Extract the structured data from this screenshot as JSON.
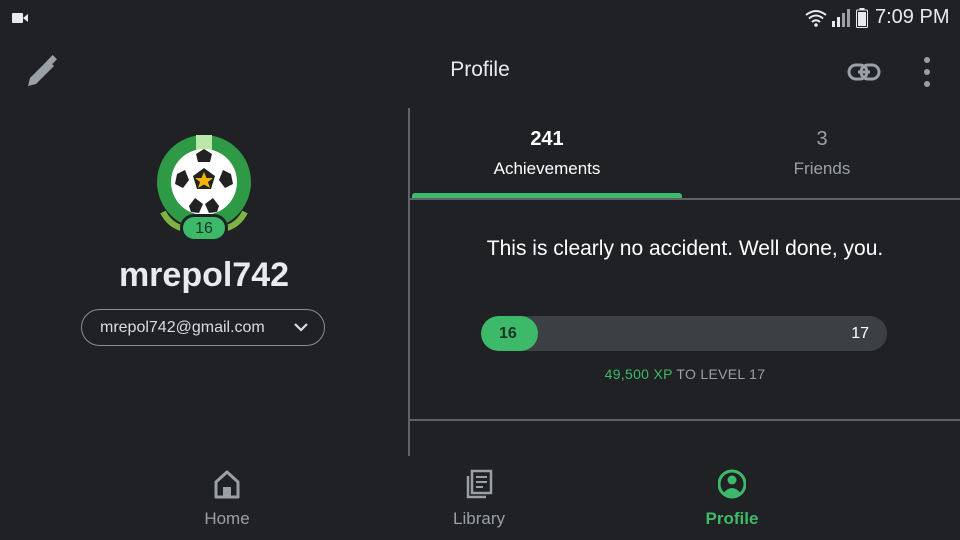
{
  "status_bar": {
    "time": "7:09 PM",
    "icons": [
      "video-icon",
      "wifi-icon",
      "signal-icon",
      "battery-icon"
    ]
  },
  "app_bar": {
    "title": "Profile",
    "icons": [
      "edit-icon",
      "link-icon",
      "more-vertical-icon"
    ]
  },
  "profile": {
    "avatar_icon": "soccer-ball-badge-icon",
    "level_badge": "16",
    "username": "mrepol742",
    "account_email": "mrepol742@gmail.com"
  },
  "tabs": [
    {
      "count": "241",
      "label": "Achievements",
      "selected": true
    },
    {
      "count": "3",
      "label": "Friends",
      "selected": false
    }
  ],
  "level_card": {
    "message": "This is clearly no accident. Well done, you.",
    "current_level": "16",
    "next_level": "17",
    "progress_fraction": 0.14,
    "xp_amount": "49,500 XP",
    "xp_suffix": "TO LEVEL 17"
  },
  "bottom_nav": [
    {
      "label": "Home",
      "icon": "home-icon",
      "selected": false
    },
    {
      "label": "Library",
      "icon": "library-icon",
      "selected": false
    },
    {
      "label": "Profile",
      "icon": "account-circle-icon",
      "selected": true
    }
  ],
  "colors": {
    "background": "#202124",
    "accent": "#3cba6a",
    "muted_text": "#9aa0a6",
    "divider": "#5f6368"
  }
}
